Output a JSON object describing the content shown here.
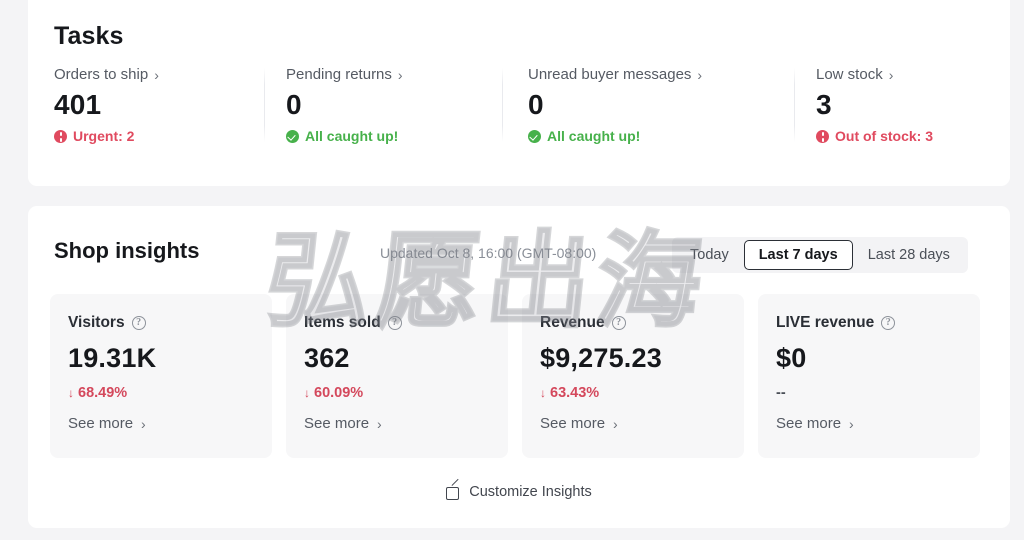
{
  "tasks": {
    "title": "Tasks",
    "items": [
      {
        "label": "Orders to ship",
        "chevron": "›",
        "value": "401",
        "status": "Urgent: 2",
        "status_type": "danger",
        "status_icon": "alert-circle-icon"
      },
      {
        "label": "Pending returns",
        "chevron": "›",
        "value": "0",
        "status": "All caught up!",
        "status_type": "ok",
        "status_icon": "check-circle-icon"
      },
      {
        "label": "Unread buyer messages",
        "chevron": "›",
        "value": "0",
        "status": "All caught up!",
        "status_type": "ok",
        "status_icon": "check-circle-icon"
      },
      {
        "label": "Low stock",
        "chevron": "›",
        "value": "3",
        "status": "Out of stock: 3",
        "status_type": "danger",
        "status_icon": "alert-circle-icon"
      }
    ]
  },
  "insights": {
    "title": "Shop insights",
    "updated": "Updated Oct 8, 16:00 (GMT-08:00)",
    "tabs": [
      {
        "label": "Today",
        "selected": false
      },
      {
        "label": "Last 7 days",
        "selected": true
      },
      {
        "label": "Last 28 days",
        "selected": false
      }
    ],
    "metrics": [
      {
        "label": "Visitors",
        "help_icon": "question-circle-icon",
        "value": "19.31K",
        "delta": "68.49%",
        "delta_dir": "down",
        "delta_arrow": "↓",
        "more": "See more",
        "chevron": "›"
      },
      {
        "label": "Items sold",
        "help_icon": "question-circle-icon",
        "value": "362",
        "delta": "60.09%",
        "delta_dir": "down",
        "delta_arrow": "↓",
        "more": "See more",
        "chevron": "›"
      },
      {
        "label": "Revenue",
        "help_icon": "question-circle-icon",
        "value": "$9,275.23",
        "delta": "63.43%",
        "delta_dir": "down",
        "delta_arrow": "↓",
        "more": "See more",
        "chevron": "›"
      },
      {
        "label": "LIVE revenue",
        "help_icon": "question-circle-icon",
        "value": "$0",
        "delta": "--",
        "delta_dir": "none",
        "delta_arrow": "",
        "more": "See more",
        "chevron": "›"
      }
    ],
    "customize": {
      "label": "Customize Insights",
      "icon": "edit-square-icon"
    }
  },
  "watermark": {
    "text": "弘愿出海"
  },
  "colors": {
    "page_bg": "#f4f4f6",
    "card_bg": "#ffffff",
    "metric_bg": "#f7f7f8",
    "danger": "#e04a5f",
    "ok": "#47b14b",
    "delta_down": "#d4485c",
    "text_primary": "#16181c",
    "text_secondary": "#555a63"
  }
}
